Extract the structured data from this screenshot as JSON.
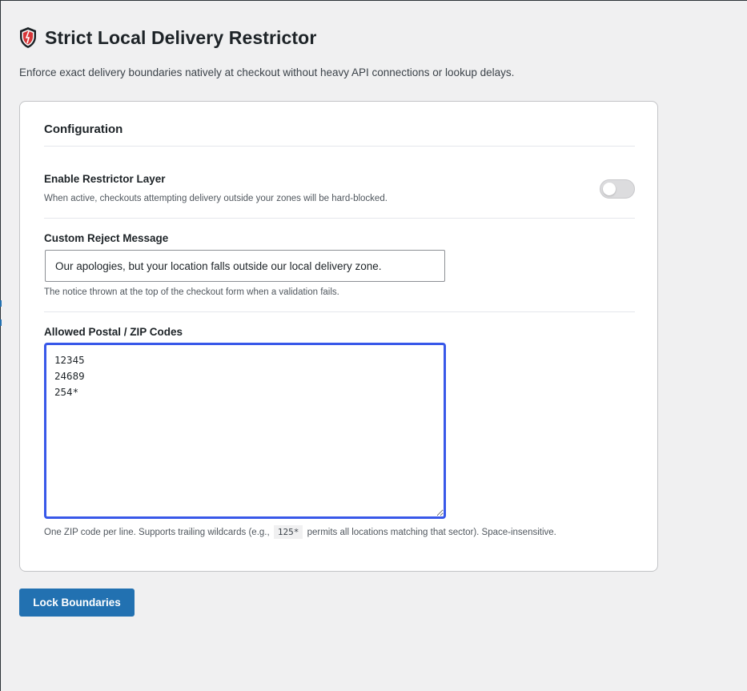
{
  "header": {
    "title": "Strict Local Delivery Restrictor",
    "subtitle": "Enforce exact delivery boundaries natively at checkout without heavy API connections or lookup delays.",
    "icon": "shield-icon"
  },
  "config": {
    "section_title": "Configuration",
    "enable": {
      "label": "Enable Restrictor Layer",
      "help": "When active, checkouts attempting delivery outside your zones will be hard-blocked.",
      "enabled": false
    },
    "reject_message": {
      "label": "Custom Reject Message",
      "value": "Our apologies, but your location falls outside our local delivery zone.",
      "help": "The notice thrown at the top of the checkout form when a validation fails."
    },
    "zip_codes": {
      "label": "Allowed Postal / ZIP Codes",
      "value": "12345\n24689\n254*",
      "help_before": "One ZIP code per line. Supports trailing wildcards (e.g.,",
      "help_code": "125*",
      "help_after": "permits all locations matching that sector). Space-insensitive."
    }
  },
  "actions": {
    "submit_label": "Lock Boundaries"
  },
  "colors": {
    "primary": "#2271b1",
    "focus": "#3858e9",
    "shield": "#d63638",
    "background": "#f0f0f1"
  }
}
